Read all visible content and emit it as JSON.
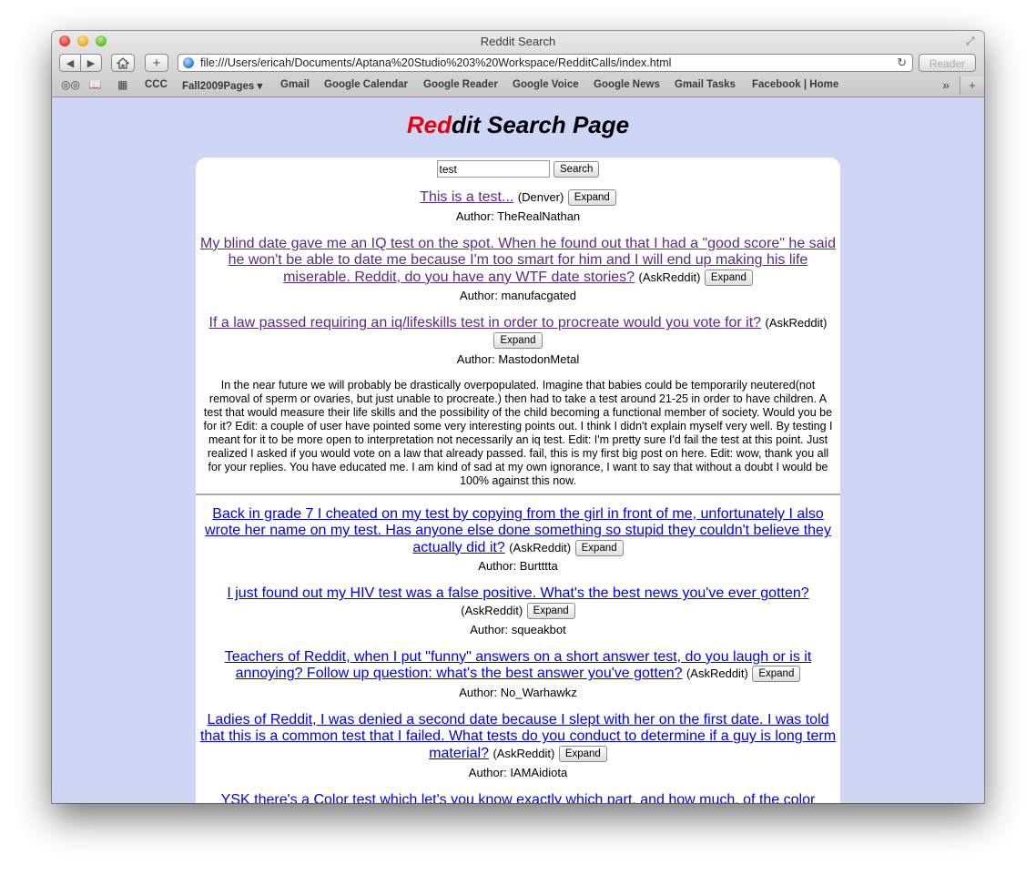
{
  "window": {
    "title": "Reddit Search"
  },
  "toolbar": {
    "url": "file:///Users/ericah/Documents/Aptana%20Studio%203%20Workspace/RedditCalls/index.html",
    "reader_label": "Reader"
  },
  "bookmarks": [
    {
      "label": "CCC"
    },
    {
      "label": "Fall2009Pages ▾"
    },
    {
      "label": "Gmail"
    },
    {
      "label": "Google Calendar"
    },
    {
      "label": "Google Reader"
    },
    {
      "label": "Google Voice"
    },
    {
      "label": "Google News"
    },
    {
      "label": "Gmail Tasks"
    },
    {
      "label": "Facebook | Home"
    }
  ],
  "page": {
    "title_red": "Red",
    "title_rest": "dit Search Page",
    "search_value": "test",
    "search_button": "Search",
    "expand_label": "Expand"
  },
  "results": [
    {
      "title": "This is a test...",
      "subreddit": "(Denver)",
      "author": "Author: TheRealNathan",
      "visited": true
    },
    {
      "title": "My blind date gave me an IQ test on the spot. When he found out that I had a \"good score\" he said he won't be able to date me because I'm too smart for him and I will end up making his life miserable. Reddit, do you have any WTF date stories?",
      "subreddit": "(AskReddit)",
      "author": "Author: manufacgated",
      "visited": true
    },
    {
      "title": "If a law passed requiring an iq/lifeskills test in order to procreate would you vote for it?",
      "subreddit": "(AskReddit)",
      "author": "Author: MastodonMetal",
      "visited": true,
      "selftext": "In the near future we will probably be drastically overpopulated. Imagine that babies could be temporarily neutered(not removal of sperm or ovaries, but just unable to procreate.) then had to take a test around 21-25 in order to have children. A test that would measure their life skills and the possibility of the child becoming a functional member of society. Would you be for it? Edit: a couple of user have pointed some very interesting points out. I think I didn't explain myself very well. By testing I meant for it to be more open to interpretation not necessarily an iq test. Edit: I'm pretty sure I'd fail the test at this point. Just realized I asked if you would vote on a law that already passed. fail, this is my first big post on here. Edit: wow, thank you all for your replies. You have educated me. I am kind of sad at my own ignorance, I want to say that without a doubt I would be 100% against this now."
    },
    {
      "title": "Back in grade 7 I cheated on my test by copying from the girl in front of me, unfortunately I also wrote her name on my test. Has anyone else done something so stupid they couldn't believe they actually did it?",
      "subreddit": "(AskReddit)",
      "author": "Author: Burtttta",
      "visited": false
    },
    {
      "title": "I just found out my HIV test was a false positive. What's the best news you've ever gotten?",
      "subreddit": "(AskReddit)",
      "author": "Author: squeakbot",
      "visited": false
    },
    {
      "title": "Teachers of Reddit, when I put \"funny\" answers on a short answer test, do you laugh or is it annoying? Follow up question: what's the best answer you've gotten?",
      "subreddit": "(AskReddit)",
      "author": "Author: No_Warhawkz",
      "visited": false
    },
    {
      "title": "Ladies of Reddit, I was denied a second date because I slept with her on the first date. I was told that this is a common test that I failed. What tests do you conduct to determine if a guy is long term material?",
      "subreddit": "(AskReddit)",
      "author": "Author: IAMAidiota",
      "visited": false
    },
    {
      "title": "YSK there's a Color test which let's you know exactly which part, and how much, of the color",
      "subreddit": "",
      "author": "",
      "visited": false
    }
  ]
}
